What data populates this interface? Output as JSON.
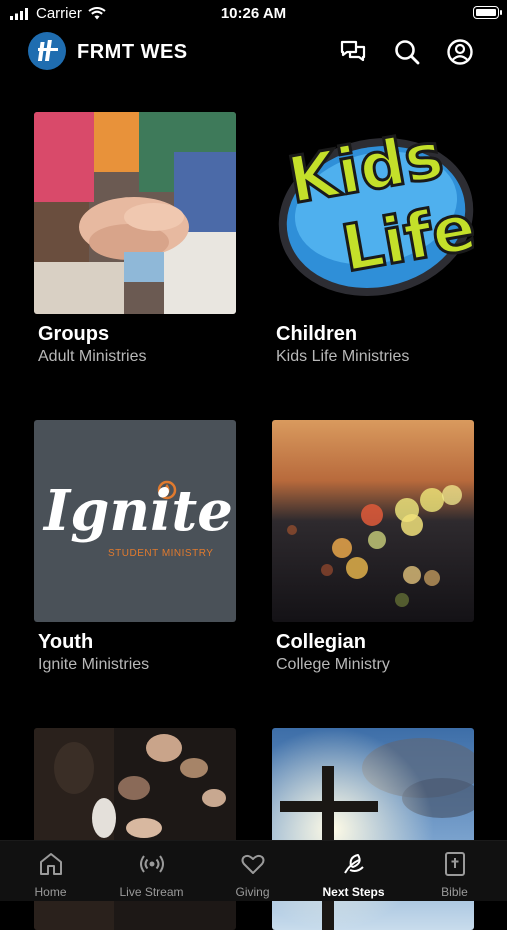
{
  "status_bar": {
    "carrier": "Carrier",
    "time": "10:26 AM"
  },
  "header": {
    "title": "FRMT WES",
    "icons": [
      "logo-icon",
      "chat-icon",
      "search-icon",
      "profile-icon"
    ]
  },
  "cards": [
    {
      "title": "Groups",
      "subtitle": "Adult Ministries"
    },
    {
      "title": "Children",
      "subtitle": "Kids Life Ministries",
      "logo_line1": "Kids",
      "logo_line2": "Life"
    },
    {
      "title": "Youth",
      "subtitle": "Ignite Ministries",
      "logo_word": "Ignite",
      "logo_tagline": "STUDENT MINISTRY"
    },
    {
      "title": "Collegian",
      "subtitle": "College Ministry"
    },
    {
      "title": "",
      "subtitle": ""
    },
    {
      "title": "",
      "subtitle": ""
    }
  ],
  "tabbar": {
    "items": [
      {
        "label": "Home",
        "icon": "home-icon"
      },
      {
        "label": "Live Stream",
        "icon": "broadcast-icon"
      },
      {
        "label": "Giving",
        "icon": "heart-icon"
      },
      {
        "label": "Next Steps",
        "icon": "leaf-icon",
        "active": true
      },
      {
        "label": "Bible",
        "icon": "bible-icon"
      }
    ]
  },
  "colors": {
    "background": "#000000",
    "logo_blue": "#1f6db0",
    "ignite_orange": "#e07a2e",
    "kids_green": "#c4e02a"
  }
}
